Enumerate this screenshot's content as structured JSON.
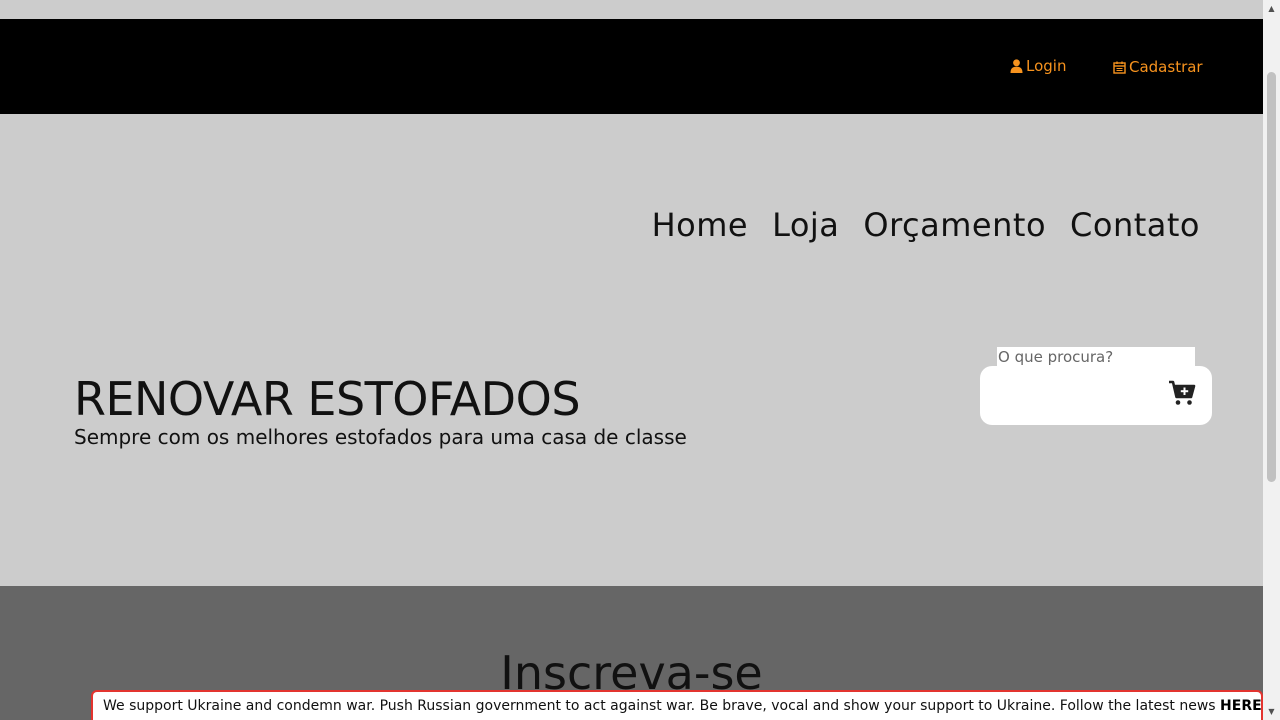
{
  "header": {
    "login_label": "Login",
    "register_label": "Cadastrar",
    "accent_color": "#f7931e"
  },
  "nav": {
    "items": [
      "Home",
      "Loja",
      "Orçamento",
      "Contato"
    ]
  },
  "hero": {
    "title": "RENOVAR ESTOFADOS",
    "subtitle": "Sempre com os melhores estofados para uma casa de classe"
  },
  "search": {
    "placeholder": "O que procura?"
  },
  "cart": {
    "icon": "cart-plus-icon"
  },
  "newsletter": {
    "title": "Inscreva-se"
  },
  "banner": {
    "text": "We support Ukraine and condemn war. Push Russian government to act against war. Be brave, vocal and show your support to Ukraine. Follow the latest news",
    "link_label": "HERE",
    "border_color": "#e3342f"
  }
}
